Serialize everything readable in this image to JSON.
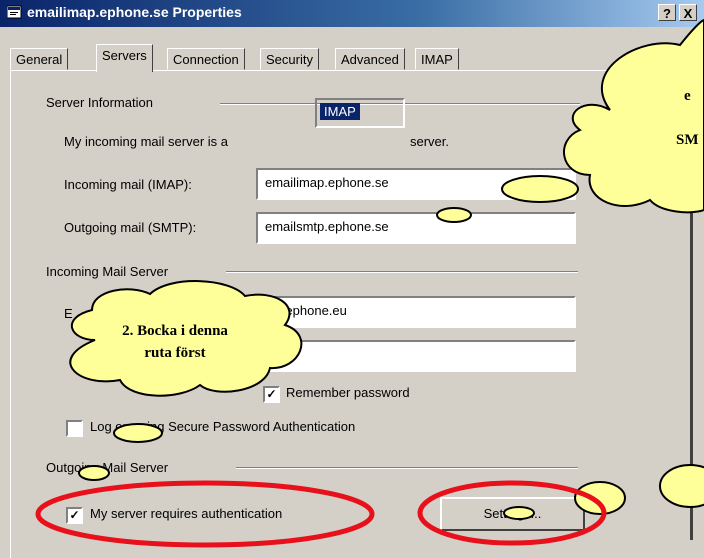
{
  "window": {
    "title": "emailimap.ephone.se Properties",
    "help_button": "?",
    "close_button": "X"
  },
  "tabs": [
    {
      "label": "General"
    },
    {
      "label": "Servers"
    },
    {
      "label": "Connection"
    },
    {
      "label": "Security"
    },
    {
      "label": "Advanced"
    },
    {
      "label": "IMAP"
    }
  ],
  "server_info": {
    "group_label": "Server Information",
    "incoming_type_prefix": "My incoming mail server is a",
    "incoming_type_value": "IMAP",
    "incoming_type_suffix": "server.",
    "incoming_label": "Incoming mail (IMAP):",
    "incoming_value": "emailimap.ephone.se",
    "outgoing_label": "Outgoing mail (SMTP):",
    "outgoing_value": "emailsmtp.ephone.se"
  },
  "incoming_server": {
    "group_label": "Incoming Mail Server",
    "account_label": "E",
    "account_value": "o@ephone.eu",
    "password_value": "●●●",
    "remember_label": "Remember password",
    "remember_checked": true,
    "spa_label": "Log on using Secure Password Authentication",
    "spa_checked": false
  },
  "outgoing_server": {
    "group_label": "Outgoing Mail Server",
    "auth_label": "My server requires authentication",
    "auth_checked": true,
    "settings_button": "Settings..."
  },
  "annotations": {
    "cloud_left_line1": "2. Bocka i denna",
    "cloud_left_line2": "ruta först",
    "cloud_right_line1": "e",
    "cloud_right_line2": "SM"
  },
  "colors": {
    "titlebar": "#0a246a",
    "dialog": "#d4d0c8",
    "cloud_fill": "#ffff99",
    "highlight_red": "#e8101a"
  }
}
